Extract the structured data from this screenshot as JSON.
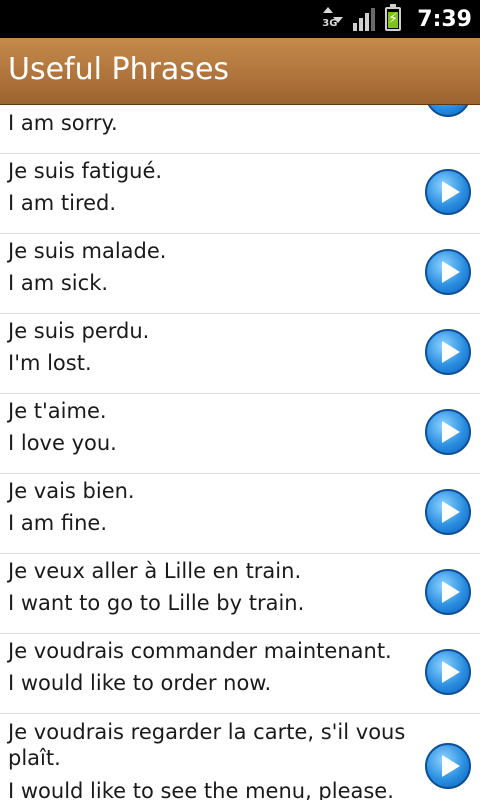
{
  "status_bar": {
    "network": "3G",
    "time": "7:39"
  },
  "app": {
    "title": "Useful Phrases"
  },
  "phrases": [
    {
      "fr": "",
      "en": "I am sorry."
    },
    {
      "fr": "Je suis fatigué.",
      "en": "I am tired."
    },
    {
      "fr": "Je suis malade.",
      "en": "I am sick."
    },
    {
      "fr": "Je suis perdu.",
      "en": "I'm lost."
    },
    {
      "fr": "Je t'aime.",
      "en": "I love you."
    },
    {
      "fr": "Je vais bien.",
      "en": "I am fine."
    },
    {
      "fr": "Je veux aller à Lille en train.",
      "en": "I want to go to Lille by train."
    },
    {
      "fr": "Je voudrais commander maintenant.",
      "en": "I would like to order now."
    },
    {
      "fr": "Je voudrais regarder la carte, s'il vous plaît.",
      "en": "I would like to see the menu, please."
    }
  ],
  "icons": {
    "play": "play-icon"
  },
  "colors": {
    "title_bar": "#b37840",
    "play_button": "#2a8fe0"
  }
}
